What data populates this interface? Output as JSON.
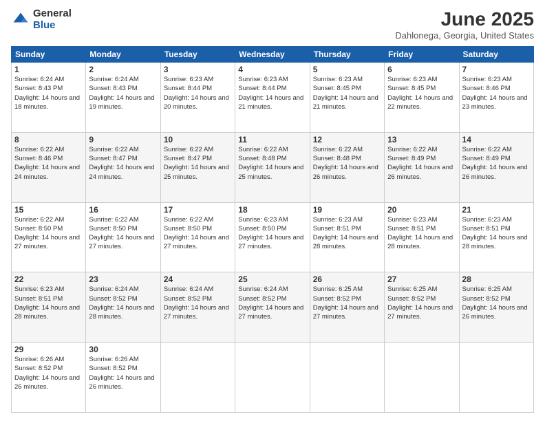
{
  "logo": {
    "general": "General",
    "blue": "Blue"
  },
  "header": {
    "month": "June 2025",
    "location": "Dahlonega, Georgia, United States"
  },
  "weekdays": [
    "Sunday",
    "Monday",
    "Tuesday",
    "Wednesday",
    "Thursday",
    "Friday",
    "Saturday"
  ],
  "weeks": [
    [
      {
        "day": "1",
        "sunrise": "6:24 AM",
        "sunset": "8:43 PM",
        "daylight": "14 hours and 18 minutes."
      },
      {
        "day": "2",
        "sunrise": "6:24 AM",
        "sunset": "8:43 PM",
        "daylight": "14 hours and 19 minutes."
      },
      {
        "day": "3",
        "sunrise": "6:23 AM",
        "sunset": "8:44 PM",
        "daylight": "14 hours and 20 minutes."
      },
      {
        "day": "4",
        "sunrise": "6:23 AM",
        "sunset": "8:44 PM",
        "daylight": "14 hours and 21 minutes."
      },
      {
        "day": "5",
        "sunrise": "6:23 AM",
        "sunset": "8:45 PM",
        "daylight": "14 hours and 21 minutes."
      },
      {
        "day": "6",
        "sunrise": "6:23 AM",
        "sunset": "8:45 PM",
        "daylight": "14 hours and 22 minutes."
      },
      {
        "day": "7",
        "sunrise": "6:23 AM",
        "sunset": "8:46 PM",
        "daylight": "14 hours and 23 minutes."
      }
    ],
    [
      {
        "day": "8",
        "sunrise": "6:22 AM",
        "sunset": "8:46 PM",
        "daylight": "14 hours and 24 minutes."
      },
      {
        "day": "9",
        "sunrise": "6:22 AM",
        "sunset": "8:47 PM",
        "daylight": "14 hours and 24 minutes."
      },
      {
        "day": "10",
        "sunrise": "6:22 AM",
        "sunset": "8:47 PM",
        "daylight": "14 hours and 25 minutes."
      },
      {
        "day": "11",
        "sunrise": "6:22 AM",
        "sunset": "8:48 PM",
        "daylight": "14 hours and 25 minutes."
      },
      {
        "day": "12",
        "sunrise": "6:22 AM",
        "sunset": "8:48 PM",
        "daylight": "14 hours and 26 minutes."
      },
      {
        "day": "13",
        "sunrise": "6:22 AM",
        "sunset": "8:49 PM",
        "daylight": "14 hours and 26 minutes."
      },
      {
        "day": "14",
        "sunrise": "6:22 AM",
        "sunset": "8:49 PM",
        "daylight": "14 hours and 26 minutes."
      }
    ],
    [
      {
        "day": "15",
        "sunrise": "6:22 AM",
        "sunset": "8:50 PM",
        "daylight": "14 hours and 27 minutes."
      },
      {
        "day": "16",
        "sunrise": "6:22 AM",
        "sunset": "8:50 PM",
        "daylight": "14 hours and 27 minutes."
      },
      {
        "day": "17",
        "sunrise": "6:22 AM",
        "sunset": "8:50 PM",
        "daylight": "14 hours and 27 minutes."
      },
      {
        "day": "18",
        "sunrise": "6:23 AM",
        "sunset": "8:50 PM",
        "daylight": "14 hours and 27 minutes."
      },
      {
        "day": "19",
        "sunrise": "6:23 AM",
        "sunset": "8:51 PM",
        "daylight": "14 hours and 28 minutes."
      },
      {
        "day": "20",
        "sunrise": "6:23 AM",
        "sunset": "8:51 PM",
        "daylight": "14 hours and 28 minutes."
      },
      {
        "day": "21",
        "sunrise": "6:23 AM",
        "sunset": "8:51 PM",
        "daylight": "14 hours and 28 minutes."
      }
    ],
    [
      {
        "day": "22",
        "sunrise": "6:23 AM",
        "sunset": "8:51 PM",
        "daylight": "14 hours and 28 minutes."
      },
      {
        "day": "23",
        "sunrise": "6:24 AM",
        "sunset": "8:52 PM",
        "daylight": "14 hours and 28 minutes."
      },
      {
        "day": "24",
        "sunrise": "6:24 AM",
        "sunset": "8:52 PM",
        "daylight": "14 hours and 27 minutes."
      },
      {
        "day": "25",
        "sunrise": "6:24 AM",
        "sunset": "8:52 PM",
        "daylight": "14 hours and 27 minutes."
      },
      {
        "day": "26",
        "sunrise": "6:25 AM",
        "sunset": "8:52 PM",
        "daylight": "14 hours and 27 minutes."
      },
      {
        "day": "27",
        "sunrise": "6:25 AM",
        "sunset": "8:52 PM",
        "daylight": "14 hours and 27 minutes."
      },
      {
        "day": "28",
        "sunrise": "6:25 AM",
        "sunset": "8:52 PM",
        "daylight": "14 hours and 26 minutes."
      }
    ],
    [
      {
        "day": "29",
        "sunrise": "6:26 AM",
        "sunset": "8:52 PM",
        "daylight": "14 hours and 26 minutes."
      },
      {
        "day": "30",
        "sunrise": "6:26 AM",
        "sunset": "8:52 PM",
        "daylight": "14 hours and 26 minutes."
      },
      null,
      null,
      null,
      null,
      null
    ]
  ]
}
